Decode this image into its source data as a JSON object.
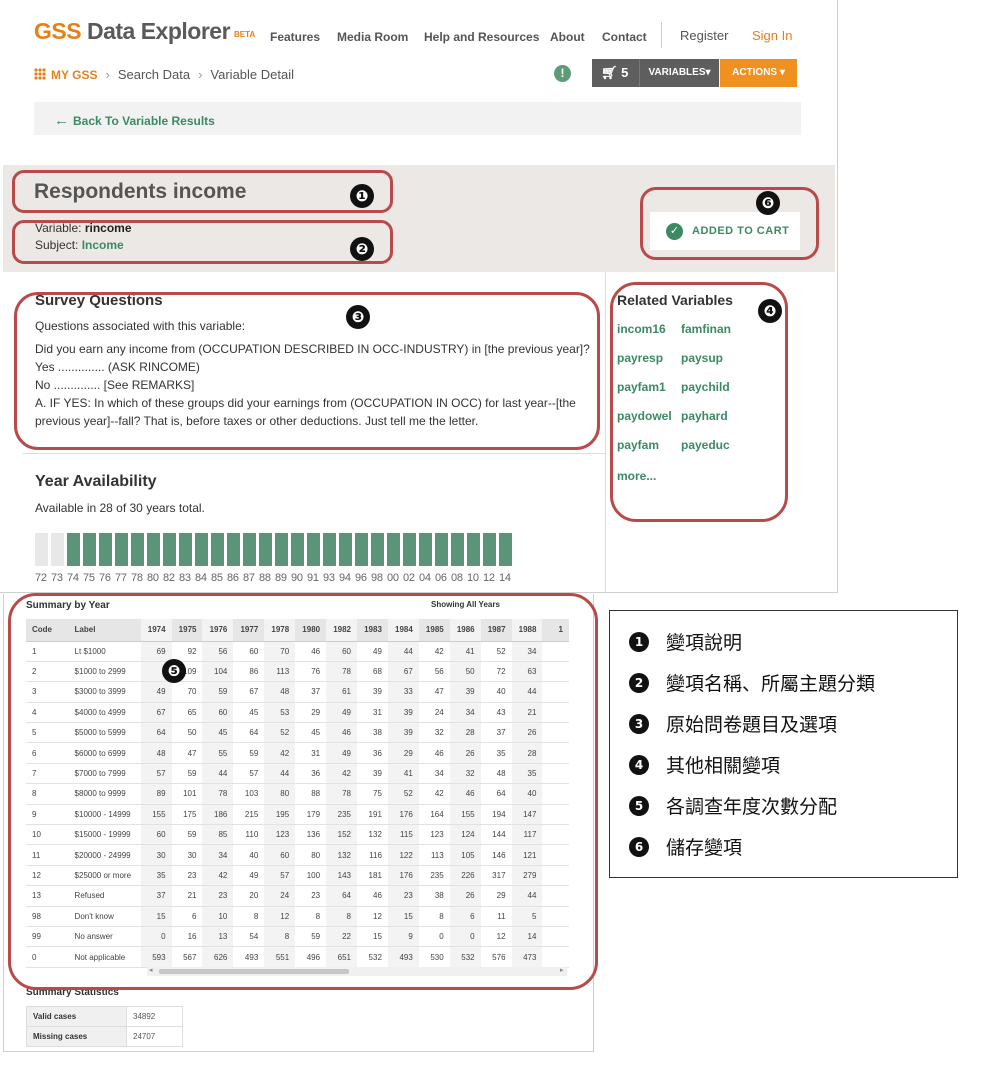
{
  "header": {
    "logo_gss": "GSS",
    "logo_de": "Data Explorer",
    "logo_beta": "BETA",
    "nav": [
      "Features",
      "Media Room",
      "Help and Resources",
      "About",
      "Contact"
    ],
    "register": "Register",
    "sign_in": "Sign In"
  },
  "breadcrumb": {
    "my_gss": "MY GSS",
    "search": "Search Data",
    "detail": "Variable Detail"
  },
  "toolbar": {
    "alert": "!",
    "cart_count": "5",
    "variables": "VARIABLES",
    "actions": "ACTIONS"
  },
  "back_link": "Back To Variable Results",
  "variable": {
    "title": "Respondents income",
    "variable_label": "Variable:",
    "variable_name": "rincome",
    "subject_label": "Subject:",
    "subject": "Income",
    "added_to_cart": "ADDED TO CART"
  },
  "survey_questions": {
    "title": "Survey Questions",
    "assoc": "Questions associated with this variable:",
    "lines": [
      "Did you earn any income from (OCCUPATION DESCRIBED IN OCC-INDUSTRY) in [the previous year]?",
      "Yes .............. (ASK RINCOME)",
      "No .............. [See REMARKS]",
      "A.  IF YES: In which of these groups did your earnings from (OCCUPATION IN OCC) for last year--[the",
      "previous year]--fall? That is, before taxes or other deductions. Just tell me the letter."
    ]
  },
  "year_availability": {
    "title": "Year Availability",
    "subtitle": "Available in 28 of 30 years total.",
    "years": [
      "72",
      "73",
      "74",
      "75",
      "76",
      "77",
      "78",
      "80",
      "82",
      "83",
      "84",
      "85",
      "86",
      "87",
      "88",
      "89",
      "90",
      "91",
      "93",
      "94",
      "96",
      "98",
      "00",
      "02",
      "04",
      "06",
      "08",
      "10",
      "12",
      "14"
    ],
    "available": [
      false,
      false,
      true,
      true,
      true,
      true,
      true,
      true,
      true,
      true,
      true,
      true,
      true,
      true,
      true,
      true,
      true,
      true,
      true,
      true,
      true,
      true,
      true,
      true,
      true,
      true,
      true,
      true,
      true,
      true
    ]
  },
  "related_variables": {
    "title": "Related Variables",
    "items": [
      "incom16",
      "famfinan",
      "payresp",
      "paysup",
      "payfam1",
      "paychild",
      "paydowel",
      "payhard",
      "payfam",
      "payeduc"
    ],
    "more": "more..."
  },
  "summary": {
    "title": "Summary by Year",
    "showing": "Showing All Years",
    "columns": [
      "Code",
      "Label",
      "1974",
      "1975",
      "1976",
      "1977",
      "1978",
      "1980",
      "1982",
      "1983",
      "1984",
      "1985",
      "1986",
      "1987",
      "1988",
      "1"
    ],
    "rows": [
      [
        "1",
        "Lt $1000",
        "69",
        "92",
        "56",
        "60",
        "70",
        "46",
        "60",
        "49",
        "44",
        "42",
        "41",
        "52",
        "34"
      ],
      [
        "2",
        "$1000 to 2999",
        "",
        "109",
        "104",
        "86",
        "113",
        "76",
        "78",
        "68",
        "67",
        "56",
        "50",
        "72",
        "63"
      ],
      [
        "3",
        "$3000 to 3999",
        "49",
        "70",
        "59",
        "67",
        "48",
        "37",
        "61",
        "39",
        "33",
        "47",
        "39",
        "40",
        "44"
      ],
      [
        "4",
        "$4000 to 4999",
        "67",
        "65",
        "60",
        "45",
        "53",
        "29",
        "49",
        "31",
        "39",
        "24",
        "34",
        "43",
        "21"
      ],
      [
        "5",
        "$5000 to 5999",
        "64",
        "50",
        "45",
        "64",
        "52",
        "45",
        "46",
        "38",
        "39",
        "32",
        "28",
        "37",
        "26"
      ],
      [
        "6",
        "$6000 to 6999",
        "48",
        "47",
        "55",
        "59",
        "42",
        "31",
        "49",
        "36",
        "29",
        "46",
        "26",
        "35",
        "28"
      ],
      [
        "7",
        "$7000 to 7999",
        "57",
        "59",
        "44",
        "57",
        "44",
        "36",
        "42",
        "39",
        "41",
        "34",
        "32",
        "48",
        "35"
      ],
      [
        "8",
        "$8000 to 9999",
        "89",
        "101",
        "78",
        "103",
        "80",
        "88",
        "78",
        "75",
        "52",
        "42",
        "46",
        "64",
        "40"
      ],
      [
        "9",
        "$10000 - 14999",
        "155",
        "175",
        "186",
        "215",
        "195",
        "179",
        "235",
        "191",
        "176",
        "164",
        "155",
        "194",
        "147"
      ],
      [
        "10",
        "$15000 - 19999",
        "60",
        "59",
        "85",
        "110",
        "123",
        "136",
        "152",
        "132",
        "115",
        "123",
        "124",
        "144",
        "117"
      ],
      [
        "11",
        "$20000 - 24999",
        "30",
        "30",
        "34",
        "40",
        "60",
        "80",
        "132",
        "116",
        "122",
        "113",
        "105",
        "146",
        "121"
      ],
      [
        "12",
        "$25000 or more",
        "35",
        "23",
        "42",
        "49",
        "57",
        "100",
        "143",
        "181",
        "176",
        "235",
        "226",
        "317",
        "279"
      ],
      [
        "13",
        "Refused",
        "37",
        "21",
        "23",
        "20",
        "24",
        "23",
        "64",
        "46",
        "23",
        "38",
        "26",
        "29",
        "44"
      ],
      [
        "98",
        "Don't know",
        "15",
        "6",
        "10",
        "8",
        "12",
        "8",
        "8",
        "12",
        "15",
        "8",
        "6",
        "11",
        "5"
      ],
      [
        "99",
        "No answer",
        "0",
        "16",
        "13",
        "54",
        "8",
        "59",
        "22",
        "15",
        "9",
        "0",
        "0",
        "12",
        "14"
      ],
      [
        "0",
        "Not applicable",
        "593",
        "567",
        "626",
        "493",
        "551",
        "496",
        "651",
        "532",
        "493",
        "530",
        "532",
        "576",
        "473"
      ]
    ]
  },
  "summary_statistics": {
    "title": "Summary Statistics",
    "rows": [
      [
        "Valid cases",
        "34892"
      ],
      [
        "Missing cases",
        "24707"
      ]
    ]
  },
  "annotations": [
    "❶",
    "❷",
    "❸",
    "❹",
    "❺",
    "❻"
  ],
  "legend": [
    {
      "num": "1",
      "text": "變項說明"
    },
    {
      "num": "2",
      "text": "變項名稱、所屬主題分類"
    },
    {
      "num": "3",
      "text": "原始問卷題目及選項"
    },
    {
      "num": "4",
      "text": "其他相關變項"
    },
    {
      "num": "5",
      "text": "各調查年度次數分配"
    },
    {
      "num": "6",
      "text": "儲存變項"
    }
  ],
  "colors": {
    "brand_orange": "#e8801a",
    "link_green": "#3c8a63",
    "bar_green": "#5b9478",
    "annotation_red": "#b84a4a"
  }
}
